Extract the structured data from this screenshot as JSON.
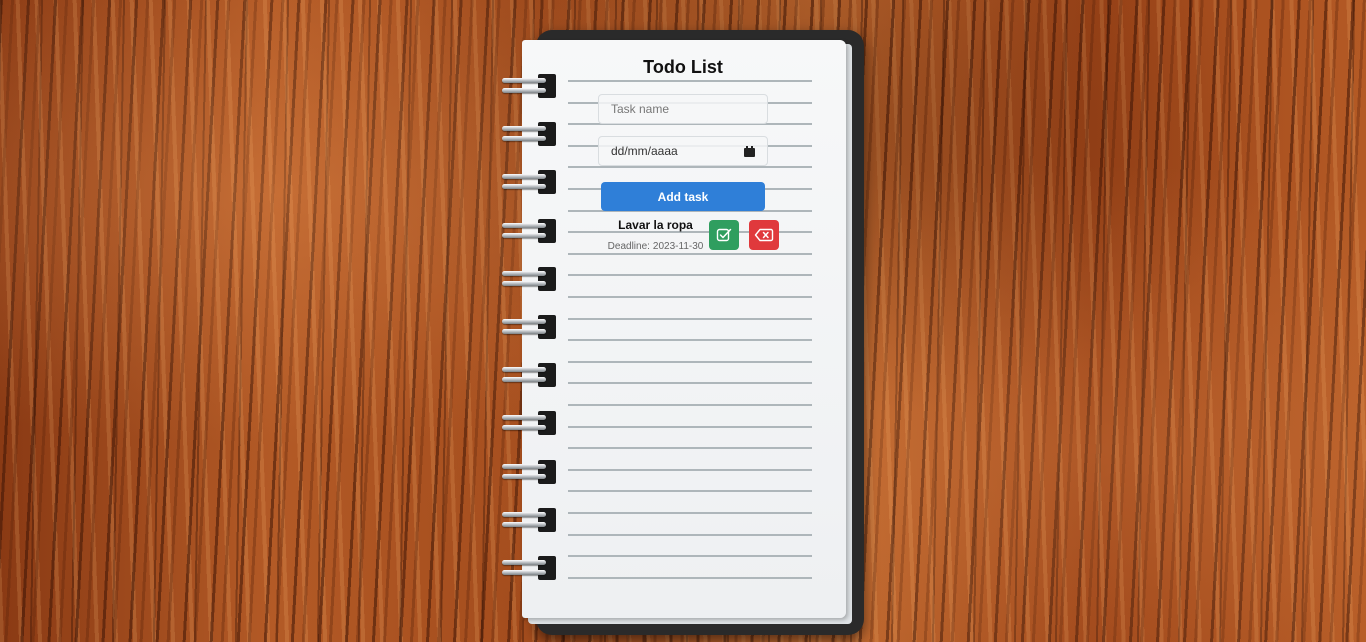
{
  "app": {
    "title": "Todo List"
  },
  "form": {
    "task_placeholder": "Task name",
    "task_value": "",
    "date_placeholder": "dd/mm/aaaa",
    "date_icon": "calendar-icon",
    "add_button_label": "Add task"
  },
  "tasks": [
    {
      "name": "Lavar la ropa",
      "deadline_label": "Deadline:",
      "deadline": "2023-11-30",
      "complete_icon": "check-square-icon",
      "delete_icon": "backspace-x-icon"
    }
  ],
  "colors": {
    "add_button": "#2f7fd8",
    "complete_button": "#2f9e5f",
    "delete_button": "#e0393c",
    "background": "wood"
  }
}
